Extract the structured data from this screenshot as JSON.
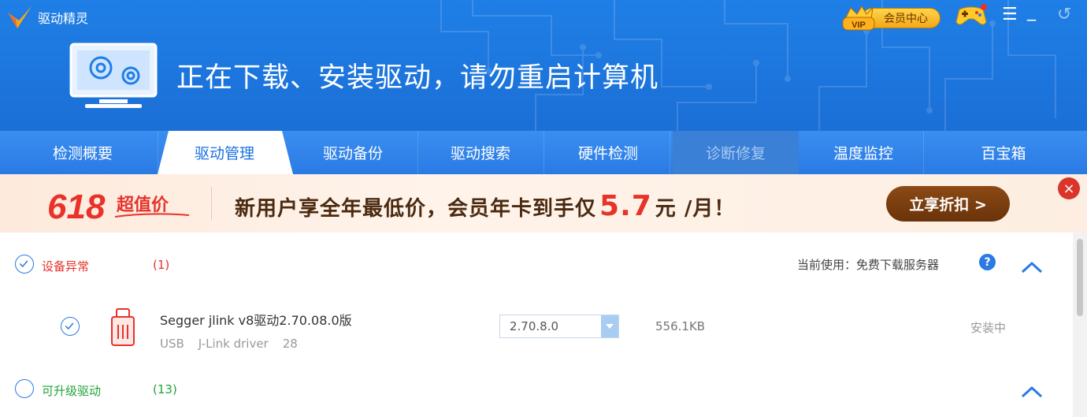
{
  "app": {
    "name": "驱动精灵"
  },
  "header": {
    "vip_label": "会员中心",
    "vip_badge": "VIP",
    "status_text": "正在下载、安装驱动，请勿重启计算机",
    "controls": [
      "menu-icon",
      "minimize-icon",
      "restore-icon"
    ]
  },
  "tabs": [
    {
      "label": "检测概要",
      "state": "normal"
    },
    {
      "label": "驱动管理",
      "state": "active"
    },
    {
      "label": "驱动备份",
      "state": "normal"
    },
    {
      "label": "驱动搜索",
      "state": "normal"
    },
    {
      "label": "硬件检测",
      "state": "normal"
    },
    {
      "label": "诊断修复",
      "state": "disabled"
    },
    {
      "label": "温度监控",
      "state": "normal"
    },
    {
      "label": "百宝箱",
      "state": "normal"
    }
  ],
  "promo": {
    "badge_number": "618",
    "badge_text": "超值价",
    "text_before": "新用户享全年最低价，会员年卡到手仅",
    "price": "5.7",
    "text_after": "元 /月！",
    "button_label": "立享折扣 >",
    "close_symbol": "×"
  },
  "sections": {
    "abnormal": {
      "label": "设备异常",
      "count": "(1)",
      "color": "#e8322a"
    },
    "server_text": "当前使用：免费下载服务器",
    "help_symbol": "?",
    "upgradable": {
      "label": "可升级驱动",
      "count": "(13)",
      "color": "#22a33a"
    }
  },
  "driver": {
    "name": "Segger jlink v8驱动2.70.08.0版",
    "bus": "USB",
    "type": "J-Link driver",
    "extra": "28",
    "version": "2.70.8.0",
    "size": "556.1KB",
    "status": "安装中"
  },
  "colors": {
    "accent": "#2a7ae4",
    "header": "#1f7fe6"
  }
}
